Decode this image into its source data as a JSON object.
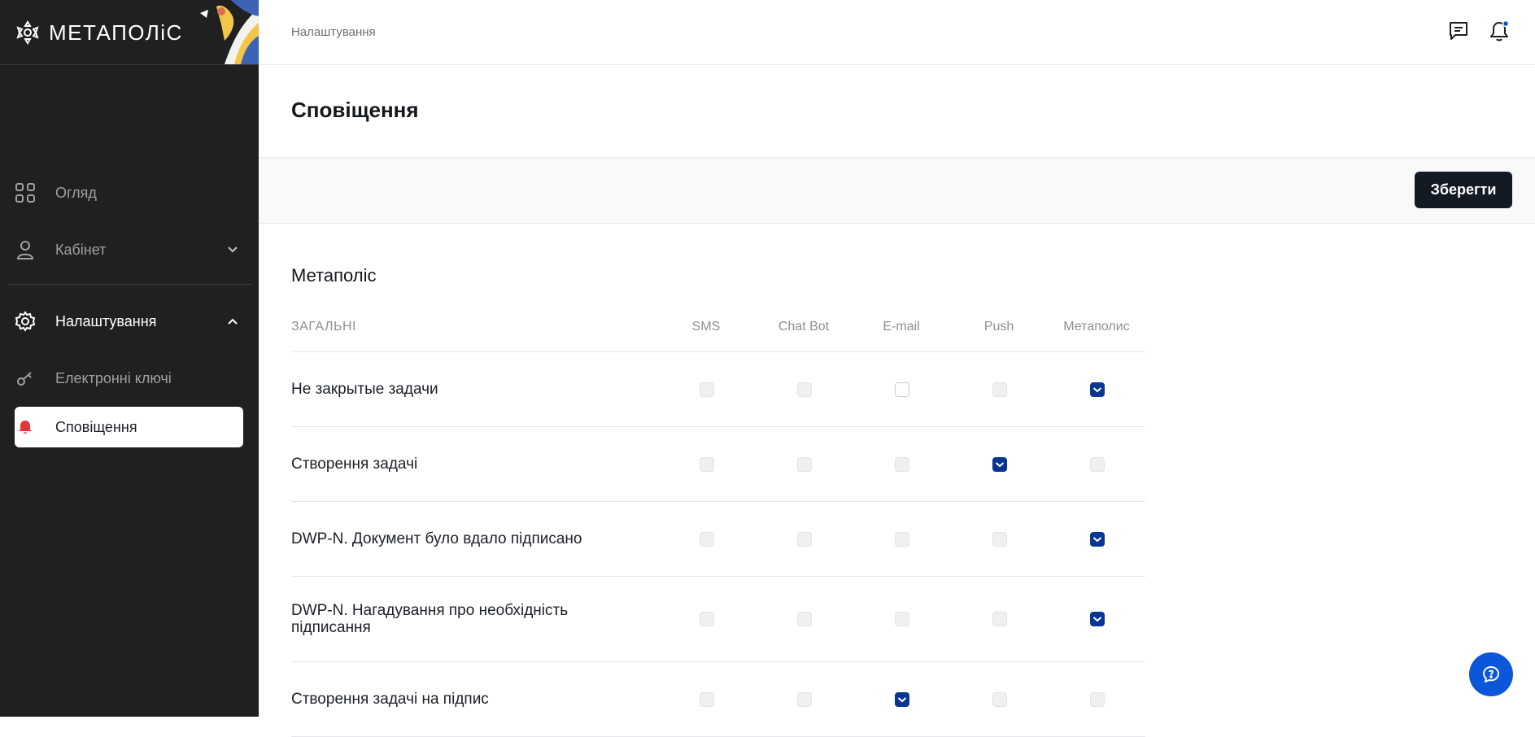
{
  "app": {
    "logo_text": "МЕТАПОЛіС"
  },
  "header": {
    "breadcrumb": "Налаштування"
  },
  "sidebar": {
    "items": [
      {
        "label": "Огляд",
        "icon": "grid-icon"
      },
      {
        "label": "Кабінет",
        "icon": "user-icon"
      },
      {
        "label": "Налаштування",
        "icon": "gear-icon"
      },
      {
        "label": "Електронні ключі",
        "icon": "key-icon"
      },
      {
        "label": "Сповіщення",
        "icon": "bell-icon"
      }
    ]
  },
  "page": {
    "title": "Сповіщення",
    "save_label": "Зберегти"
  },
  "section": {
    "title": "Метаполіс",
    "group_label": "ЗАГАЛЬНІ",
    "columns": [
      "SMS",
      "Chat Bot",
      "E-mail",
      "Push",
      "Метаполис"
    ]
  },
  "rows": [
    {
      "label": "Не закрытые задачи",
      "states": [
        "disabled",
        "disabled",
        "unchecked",
        "disabled",
        "checked"
      ]
    },
    {
      "label": "Створення задачі",
      "states": [
        "disabled",
        "disabled",
        "disabled",
        "checked",
        "disabled"
      ]
    },
    {
      "label": "DWP-N. Документ було вдало підписано",
      "states": [
        "disabled",
        "disabled",
        "disabled",
        "disabled",
        "checked"
      ]
    },
    {
      "label": "DWP-N. Нагадування про необхідність підписання",
      "states": [
        "disabled",
        "disabled",
        "disabled",
        "disabled",
        "checked"
      ]
    },
    {
      "label": "Створення задачі на підпис",
      "states": [
        "disabled",
        "disabled",
        "checked",
        "disabled",
        "disabled"
      ]
    }
  ],
  "colors": {
    "sidebar_bg": "#202020",
    "checkbox_on": "#0a3591",
    "fab": "#0b56d9",
    "save_btn": "#141a24"
  }
}
